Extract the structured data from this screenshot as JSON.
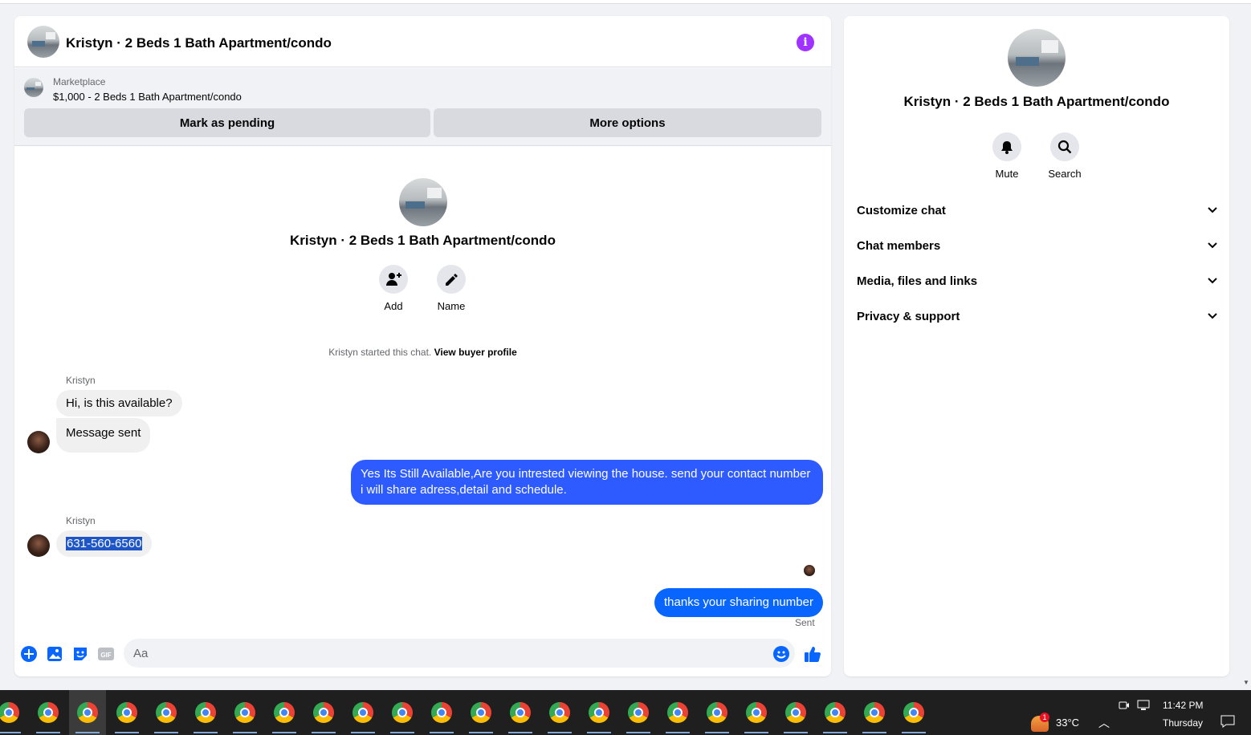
{
  "header": {
    "title": "Kristyn · 2 Beds 1 Bath Apartment/condo",
    "info_icon": "info-icon"
  },
  "marketplace": {
    "label": "Marketplace",
    "listing": "$1,000 - 2 Beds 1 Bath Apartment/condo",
    "mark_pending_label": "Mark as pending",
    "more_options_label": "More options"
  },
  "intro": {
    "title": "Kristyn · 2 Beds 1 Bath Apartment/condo",
    "add_label": "Add",
    "name_label": "Name",
    "started_text": "Kristyn started this chat. ",
    "buyer_profile_link": "View buyer profile"
  },
  "messages": [
    {
      "sender": "Kristyn",
      "text": "Hi, is this available?",
      "direction": "in"
    },
    {
      "text": "Message sent",
      "direction": "in"
    },
    {
      "text": "Yes Its Still Available,Are you intrested viewing the house. send your contact number i will share adress,detail and schedule.",
      "direction": "out"
    },
    {
      "sender": "Kristyn",
      "text": "631-560-6560",
      "direction": "in",
      "selected": true
    },
    {
      "text": "thanks your sharing number",
      "direction": "out",
      "status": "Sent"
    }
  ],
  "composer": {
    "placeholder": "Aa",
    "icons": [
      "plus-circle-icon",
      "photo-icon",
      "sticker-icon",
      "gif-icon",
      "emoji-icon",
      "thumbs-up-icon"
    ],
    "gif_label": "GIF"
  },
  "sidebar": {
    "title": "Kristyn · 2 Beds 1 Bath Apartment/condo",
    "mute_label": "Mute",
    "search_label": "Search",
    "sections": [
      {
        "label": "Customize chat"
      },
      {
        "label": "Chat members"
      },
      {
        "label": "Media, files and links"
      },
      {
        "label": "Privacy & support"
      }
    ]
  },
  "taskbar": {
    "app_count": 24,
    "app_icon": "chrome-icon",
    "weather_badge": "1",
    "temperature": "33°C",
    "time": "11:42 PM",
    "day": "Thursday"
  },
  "colors": {
    "accent": "#0866ff",
    "outgoing_bubble": "#2e5bff",
    "info": "#a033ff",
    "incoming_bubble": "#f0f0f0",
    "taskbar": "#1f1f1f"
  }
}
